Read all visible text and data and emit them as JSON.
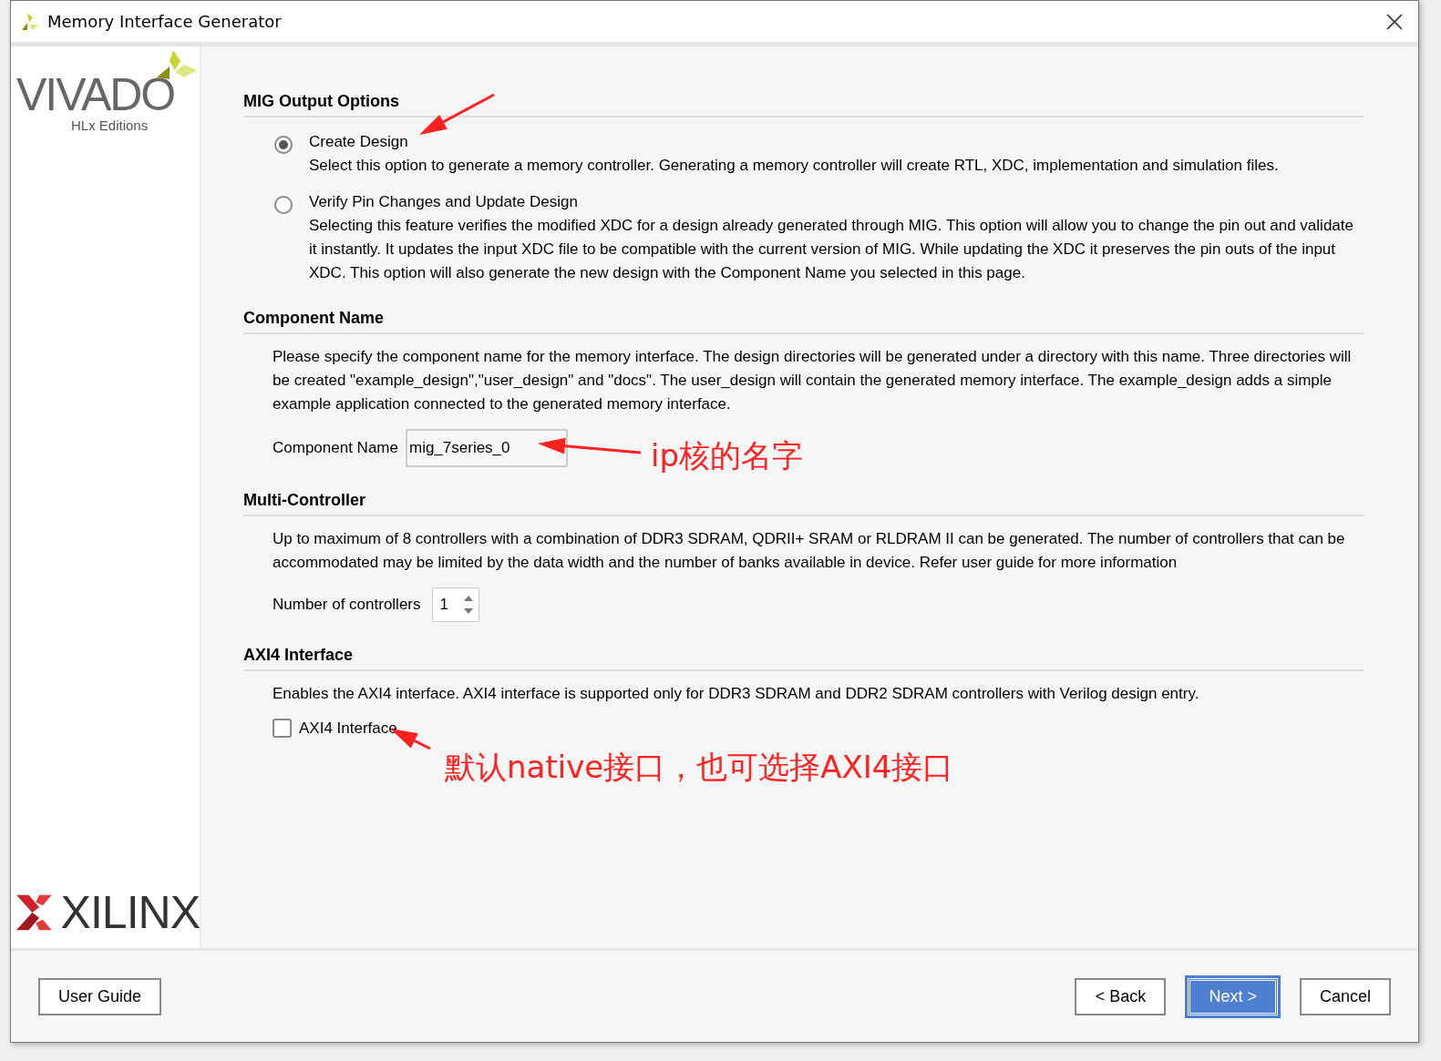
{
  "window": {
    "title": "Memory Interface Generator"
  },
  "sidebar": {
    "top_logo": "VIVADO",
    "top_logo_sub": "HLx Editions",
    "bottom_logo": "XILINX"
  },
  "sections": [
    {
      "kind": "radios",
      "title": "MIG Output Options",
      "options": [
        {
          "label": "Create Design",
          "description": "Select this option to generate a memory controller. Generating a memory controller will create RTL, XDC, implementation and simulation files.",
          "selected": true
        },
        {
          "label": "Verify Pin Changes and Update Design",
          "description": "Selecting this feature verifies the modified XDC for a design already generated through MIG. This option will allow you to change the pin out and validate it instantly. It updates the input XDC file to be compatible with the current version of MIG. While updating the XDC it preserves the pin outs of the input XDC. This option will also generate the new design with the Component Name you selected in this page.",
          "selected": false
        }
      ]
    },
    {
      "kind": "textfield",
      "title": "Component Name",
      "description": "Please specify the component name for the memory interface. The design directories will be generated under a directory with this name. Three directories will be created \"example_design\",\"user_design\" and \"docs\". The user_design will contain the generated memory interface. The example_design adds a simple example application connected to the generated memory interface.",
      "field_label": "Component Name",
      "value": "mig_7series_0"
    },
    {
      "kind": "spinner",
      "title": "Multi-Controller",
      "description": "Up to maximum of 8 controllers with a combination of DDR3 SDRAM, QDRII+ SRAM or RLDRAM II can be generated. The number of controllers that can be accommodated may be limited by the data width and the number of banks available in device. Refer user guide for more information",
      "field_label": "Number of controllers",
      "value": "1"
    },
    {
      "kind": "checkbox",
      "title": "AXI4 Interface",
      "description": "Enables the AXI4 interface. AXI4 interface is supported only for DDR3 SDRAM and DDR2 SDRAM controllers with Verilog design entry.",
      "field_label": "AXI4 Interface",
      "checked": false
    }
  ],
  "annotations": [
    {
      "text": "ip核的名字"
    },
    {
      "text": "默认native接口，也可选择AXI4接口"
    }
  ],
  "footer": {
    "left_button": "User Guide",
    "buttons": [
      {
        "label": "< Back",
        "primary": false
      },
      {
        "label": "Next >",
        "primary": true
      },
      {
        "label": "Cancel",
        "primary": false
      }
    ]
  }
}
